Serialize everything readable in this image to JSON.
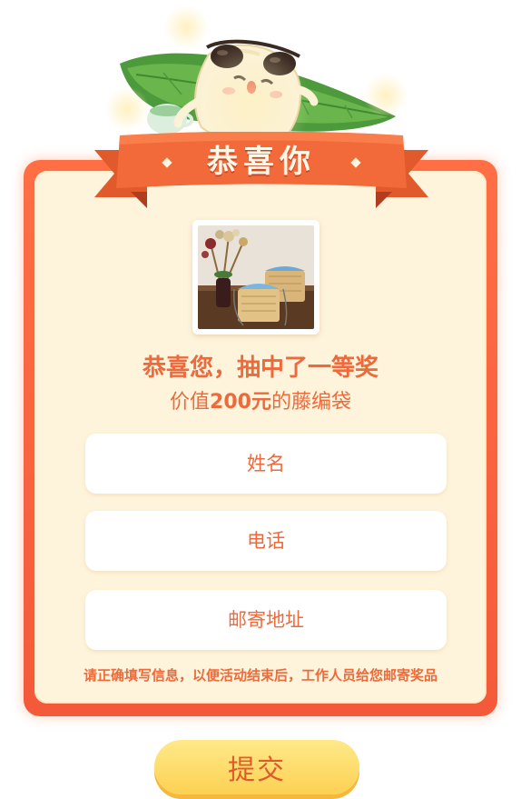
{
  "banner": {
    "title": "恭喜你"
  },
  "prize": {
    "image_icon": "rattan-bag-photo",
    "title": "恭喜您，抽中了一等奖",
    "value_prefix": "价值",
    "value_amount": "200元",
    "value_suffix": "的藤编袋"
  },
  "form": {
    "name_placeholder": "姓名",
    "phone_placeholder": "电话",
    "address_placeholder": "邮寄地址",
    "notice": "请正确填写信息，以便活动结束后，工作人员给您邮寄奖品"
  },
  "submit_label": "提交",
  "colors": {
    "accent": "#ec6a3c",
    "card_border": "#f45a39",
    "card_bg": "#fef4db",
    "button": "#fcd152"
  }
}
